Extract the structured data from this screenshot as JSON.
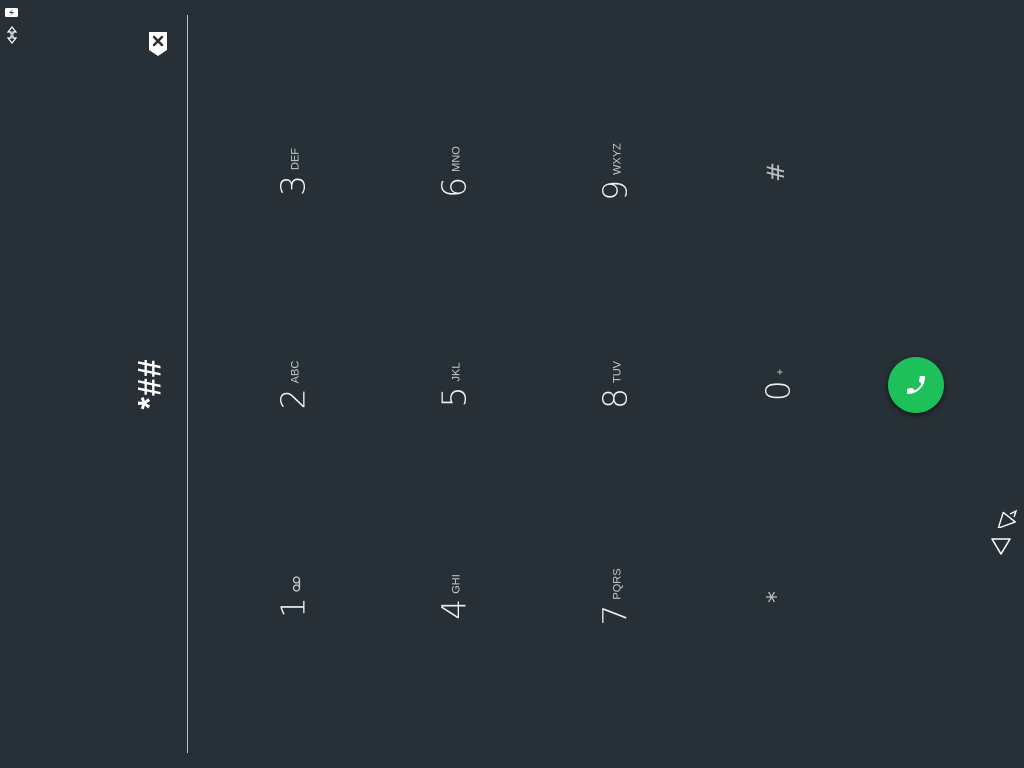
{
  "dialer": {
    "dialed_number": "*##"
  },
  "keypad": {
    "keys": [
      {
        "digit": "1",
        "letters": "",
        "voicemail": true
      },
      {
        "digit": "2",
        "letters": "ABC"
      },
      {
        "digit": "3",
        "letters": "DEF"
      },
      {
        "digit": "4",
        "letters": "GHI"
      },
      {
        "digit": "5",
        "letters": "JKL"
      },
      {
        "digit": "6",
        "letters": "MNO"
      },
      {
        "digit": "7",
        "letters": "PQRS"
      },
      {
        "digit": "8",
        "letters": "TUV"
      },
      {
        "digit": "9",
        "letters": "WXYZ"
      },
      {
        "digit": "*",
        "letters": ""
      },
      {
        "digit": "0",
        "letters": "+"
      },
      {
        "digit": "#",
        "letters": ""
      }
    ]
  },
  "icons": {
    "backspace": "backspace-icon",
    "call": "phone-icon",
    "voicemail": "voicemail-icon",
    "back": "back-triangle-icon",
    "cursor": "cursor-icon",
    "battery": "battery-charging-icon",
    "signal": "data-arrows-icon"
  },
  "colors": {
    "background": "#263036",
    "call_button": "#1ec05a",
    "divider": "#b9c0c4"
  }
}
